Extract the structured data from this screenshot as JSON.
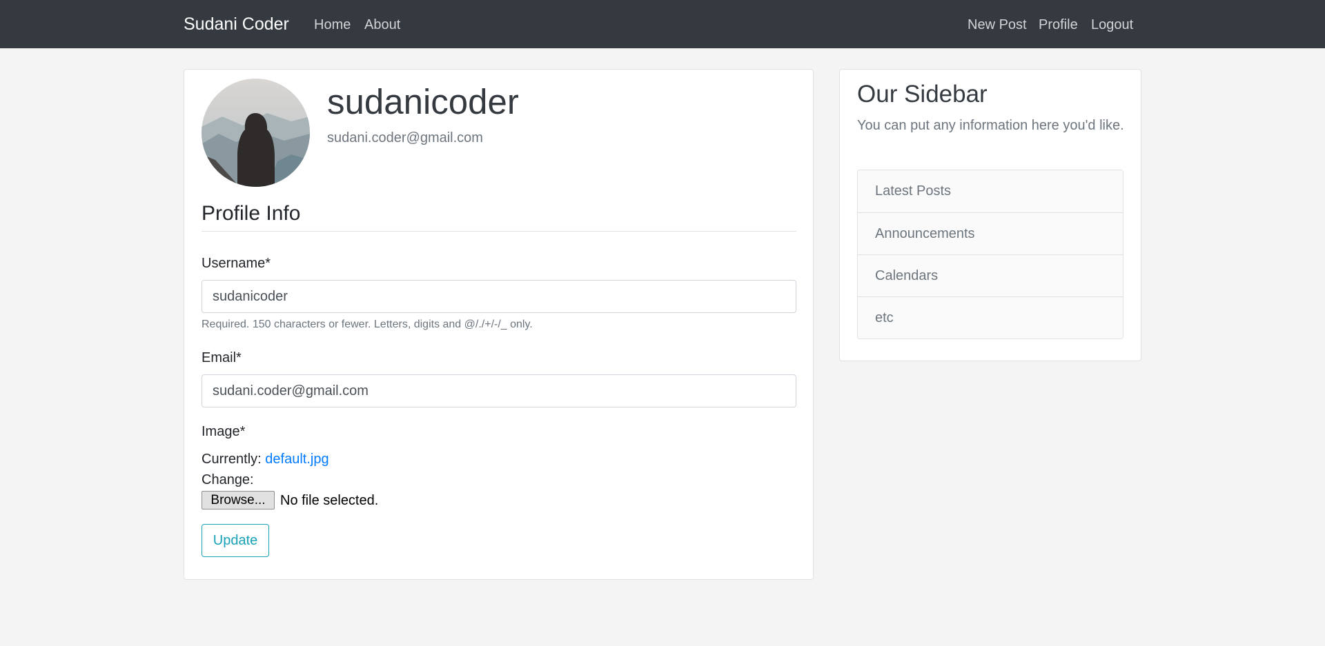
{
  "navbar": {
    "brand": "Sudani Coder",
    "left_links": [
      "Home",
      "About"
    ],
    "right_links": [
      "New Post",
      "Profile",
      "Logout"
    ],
    "background": "#343a40"
  },
  "profile": {
    "username": "sudanicoder",
    "email": "sudani.coder@gmail.com",
    "avatar": "hooded-figure-mountains-avatar"
  },
  "form": {
    "section_title": "Profile Info",
    "username_label": "Username*",
    "username_value": "sudanicoder",
    "username_help": "Required. 150 characters or fewer. Letters, digits and @/./+/-/_ only.",
    "email_label": "Email*",
    "email_value": "sudani.coder@gmail.com",
    "image_label": "Image*",
    "currently_label": "Currently:",
    "current_file": "default.jpg",
    "change_label": "Change:",
    "browse_label": "Browse...",
    "file_status": "No file selected.",
    "submit_label": "Update"
  },
  "sidebar": {
    "title": "Our Sidebar",
    "text": "You can put any information here you'd like.",
    "items": [
      "Latest Posts",
      "Announcements",
      "Calendars",
      "etc"
    ]
  },
  "colors": {
    "page_bg": "#f4f4f4",
    "link": "#007bff",
    "update_button": "#17a2b8",
    "muted_text": "#6c757d"
  }
}
